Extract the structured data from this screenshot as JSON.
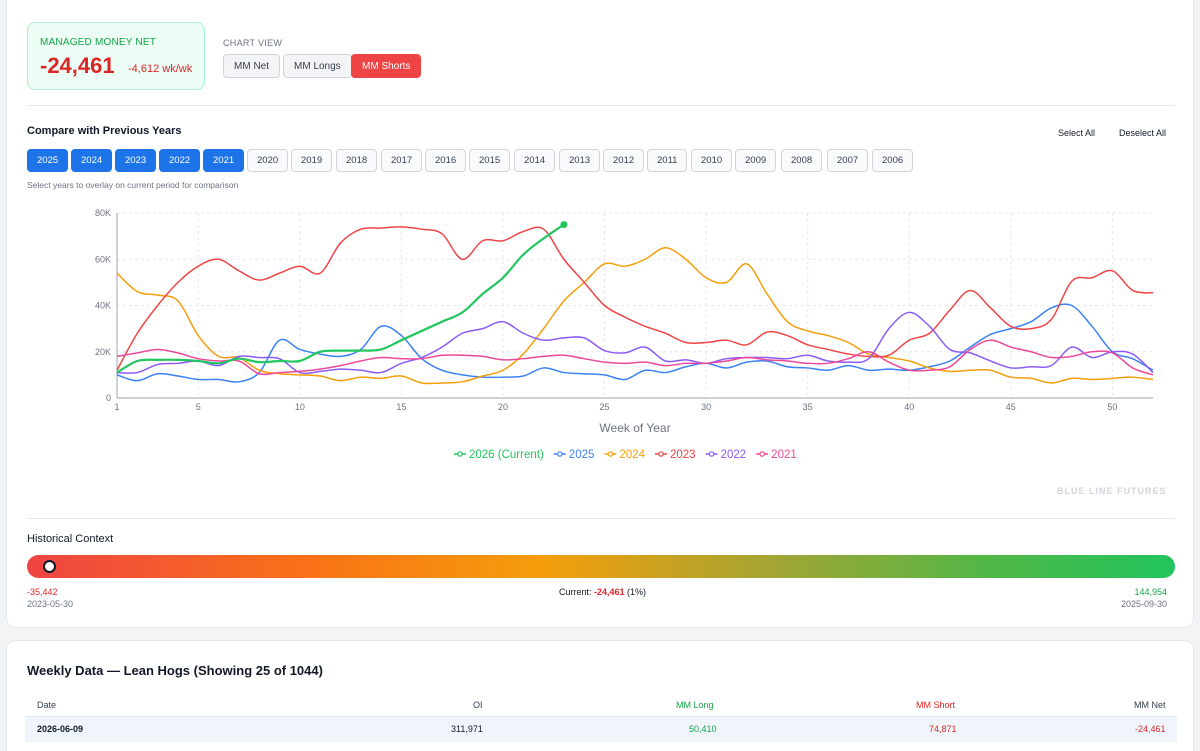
{
  "net": {
    "label": "MANAGED MONEY NET",
    "value": "-24,461",
    "change": "-4,612 wk/wk"
  },
  "chart_view": {
    "label": "CHART VIEW",
    "options": [
      "MM Net",
      "MM Longs",
      "MM Shorts"
    ],
    "active": "MM Shorts"
  },
  "compare": {
    "title": "Compare with Previous Years",
    "select_all": "Select All",
    "deselect_all": "Deselect All",
    "years": [
      "2025",
      "2024",
      "2023",
      "2022",
      "2021",
      "2020",
      "2019",
      "2018",
      "2017",
      "2016",
      "2015",
      "2014",
      "2013",
      "2012",
      "2011",
      "2010",
      "2009",
      "2008",
      "2007",
      "2006"
    ],
    "active_years": [
      "2025",
      "2024",
      "2023",
      "2022",
      "2021"
    ],
    "hint": "Select years to overlay on current period for comparison"
  },
  "watermark": "BLUE LINE FUTURES",
  "colors": {
    "2026": "#22c55e",
    "2025": "#3b82f6",
    "2024": "#f59e0b",
    "2023": "#ef4444",
    "2022": "#8b5cf6",
    "2021": "#ec4899"
  },
  "chart_data": {
    "type": "line",
    "xlabel": "Week of Year",
    "ylabel": "",
    "xlim": [
      1,
      52
    ],
    "ylim": [
      0,
      80000
    ],
    "xticks": [
      1,
      5,
      10,
      15,
      20,
      25,
      30,
      35,
      40,
      45,
      50
    ],
    "yticks": [
      0,
      20000,
      40000,
      60000,
      80000
    ],
    "ytick_labels": [
      "0",
      "20K",
      "40K",
      "60K",
      "80K"
    ],
    "grid": true,
    "legend": "bottom",
    "series": [
      {
        "name": "2026 (Current)",
        "color": "#22c55e",
        "x": [
          1,
          2,
          3,
          4,
          5,
          6,
          7,
          8,
          9,
          10,
          11,
          12,
          13,
          14,
          15,
          16,
          17,
          18,
          19,
          20,
          21,
          22,
          23
        ],
        "values": [
          11000,
          16000,
          16500,
          16500,
          16000,
          15000,
          17000,
          15500,
          16000,
          16000,
          20000,
          20500,
          20500,
          21000,
          25000,
          29000,
          33000,
          37000,
          45000,
          52000,
          62000,
          69000,
          75000
        ]
      },
      {
        "name": "2025",
        "color": "#3b82f6",
        "x": [
          1,
          2,
          3,
          4,
          5,
          6,
          7,
          8,
          9,
          10,
          11,
          12,
          13,
          14,
          15,
          16,
          17,
          18,
          19,
          20,
          21,
          22,
          23,
          24,
          25,
          26,
          27,
          28,
          29,
          30,
          31,
          32,
          33,
          34,
          35,
          36,
          37,
          38,
          39,
          40,
          41,
          42,
          43,
          44,
          45,
          46,
          47,
          48,
          49,
          50,
          51,
          52
        ],
        "values": [
          10000,
          7500,
          10500,
          9500,
          8000,
          8000,
          7000,
          11000,
          25000,
          21000,
          19000,
          18000,
          21000,
          31000,
          27000,
          17000,
          12000,
          10000,
          9000,
          9000,
          9500,
          13000,
          11000,
          10500,
          10000,
          8000,
          12000,
          11000,
          13500,
          15000,
          13000,
          15500,
          16000,
          13500,
          13000,
          12000,
          14000,
          12000,
          12500,
          12000,
          13500,
          16000,
          22000,
          27500,
          30000,
          33000,
          39000,
          40000,
          31000,
          20000,
          17000,
          12000
        ]
      },
      {
        "name": "2024",
        "color": "#f59e0b",
        "x": [
          1,
          2,
          3,
          4,
          5,
          6,
          7,
          8,
          9,
          10,
          11,
          12,
          13,
          14,
          15,
          16,
          17,
          18,
          19,
          20,
          21,
          22,
          23,
          24,
          25,
          26,
          27,
          28,
          29,
          30,
          31,
          32,
          33,
          34,
          35,
          36,
          37,
          38,
          39,
          40,
          41,
          42,
          43,
          44,
          45,
          46,
          47,
          48,
          49,
          50,
          51,
          52
        ],
        "values": [
          54000,
          46000,
          44500,
          42000,
          27000,
          18000,
          17500,
          12000,
          10500,
          10000,
          9500,
          7500,
          9000,
          8500,
          9500,
          6500,
          6500,
          7000,
          9500,
          12000,
          19000,
          30000,
          42000,
          50000,
          58000,
          57000,
          60000,
          65000,
          60000,
          52000,
          50000,
          58000,
          45000,
          33000,
          29000,
          27000,
          24000,
          19000,
          17500,
          16000,
          13000,
          11500,
          12000,
          12000,
          9000,
          8500,
          6500,
          8500,
          8000,
          8500,
          9000,
          8000
        ]
      },
      {
        "name": "2023",
        "color": "#ef4444",
        "x": [
          1,
          2,
          3,
          4,
          5,
          6,
          7,
          8,
          9,
          10,
          11,
          12,
          13,
          14,
          15,
          16,
          17,
          18,
          19,
          20,
          21,
          22,
          23,
          24,
          25,
          26,
          27,
          28,
          29,
          30,
          31,
          32,
          33,
          34,
          35,
          36,
          37,
          38,
          39,
          40,
          41,
          42,
          43,
          44,
          45,
          46,
          47,
          48,
          49,
          50,
          51,
          52
        ],
        "values": [
          12000,
          28000,
          40000,
          50000,
          57000,
          60000,
          55000,
          51000,
          54000,
          57000,
          54000,
          67000,
          73000,
          73500,
          74000,
          73000,
          71000,
          60000,
          68000,
          68000,
          72000,
          73000,
          60000,
          50000,
          40000,
          35000,
          31000,
          28000,
          24000,
          24000,
          25000,
          23000,
          28500,
          27000,
          23000,
          21000,
          19000,
          18000,
          18500,
          25000,
          28000,
          38000,
          46500,
          39000,
          31000,
          30000,
          34000,
          50500,
          52000,
          55000,
          46500,
          45500
        ]
      },
      {
        "name": "2022",
        "color": "#8b5cf6",
        "x": [
          1,
          2,
          3,
          4,
          5,
          6,
          7,
          8,
          9,
          10,
          11,
          12,
          13,
          14,
          15,
          16,
          17,
          18,
          19,
          20,
          21,
          22,
          23,
          24,
          25,
          26,
          27,
          28,
          29,
          30,
          31,
          32,
          33,
          34,
          35,
          36,
          37,
          38,
          39,
          40,
          41,
          42,
          43,
          44,
          45,
          46,
          47,
          48,
          49,
          50,
          51,
          52
        ],
        "values": [
          11000,
          11000,
          14500,
          15000,
          16000,
          14000,
          18000,
          17500,
          17000,
          11000,
          11500,
          12500,
          12000,
          11000,
          15000,
          17500,
          22000,
          28000,
          30000,
          33000,
          28000,
          25000,
          26000,
          26000,
          20500,
          19500,
          22000,
          16000,
          16500,
          15000,
          17000,
          17500,
          17500,
          17000,
          18500,
          16000,
          15500,
          17000,
          30000,
          37000,
          31000,
          21000,
          19500,
          16000,
          13000,
          13500,
          14000,
          22000,
          17500,
          20000,
          19000,
          11000
        ]
      },
      {
        "name": "2021",
        "color": "#ec4899",
        "x": [
          1,
          2,
          3,
          4,
          5,
          6,
          7,
          8,
          9,
          10,
          11,
          12,
          13,
          14,
          15,
          16,
          17,
          18,
          19,
          20,
          21,
          22,
          23,
          24,
          25,
          26,
          27,
          28,
          29,
          30,
          31,
          32,
          33,
          34,
          35,
          36,
          37,
          38,
          39,
          40,
          41,
          42,
          43,
          44,
          45,
          46,
          47,
          48,
          49,
          50,
          51,
          52
        ],
        "values": [
          18000,
          19500,
          21000,
          19500,
          17000,
          16000,
          16000,
          10500,
          11000,
          11500,
          12500,
          14000,
          16000,
          17500,
          17000,
          17000,
          18500,
          18500,
          18000,
          16500,
          17000,
          18000,
          18500,
          17000,
          15500,
          15000,
          15500,
          14000,
          15000,
          15000,
          16000,
          17500,
          16500,
          16000,
          15000,
          15000,
          17000,
          20000,
          15500,
          12000,
          12000,
          13500,
          21000,
          25000,
          22000,
          20000,
          17500,
          18000,
          20000,
          19500,
          13000,
          10000
        ]
      }
    ]
  },
  "historical": {
    "title": "Historical Context",
    "position_pct": 1,
    "min_value": "-35,442",
    "min_date": "2023-05-30",
    "current_prefix": "Current: ",
    "current_value": "-24,461",
    "current_pct": " (1%)",
    "max_value": "144,954",
    "max_date": "2025-09-30"
  },
  "weekly": {
    "title": "Weekly Data — Lean Hogs (Showing 25 of 1044)",
    "headers": {
      "date": "Date",
      "oi": "OI",
      "mm_long": "MM Long",
      "mm_short": "MM Short",
      "mm_net": "MM Net"
    },
    "rows": [
      {
        "date": "2026-06-09",
        "oi": "311,971",
        "mm_long": "50,410",
        "mm_short": "74,871",
        "mm_net": "-24,461"
      }
    ]
  }
}
